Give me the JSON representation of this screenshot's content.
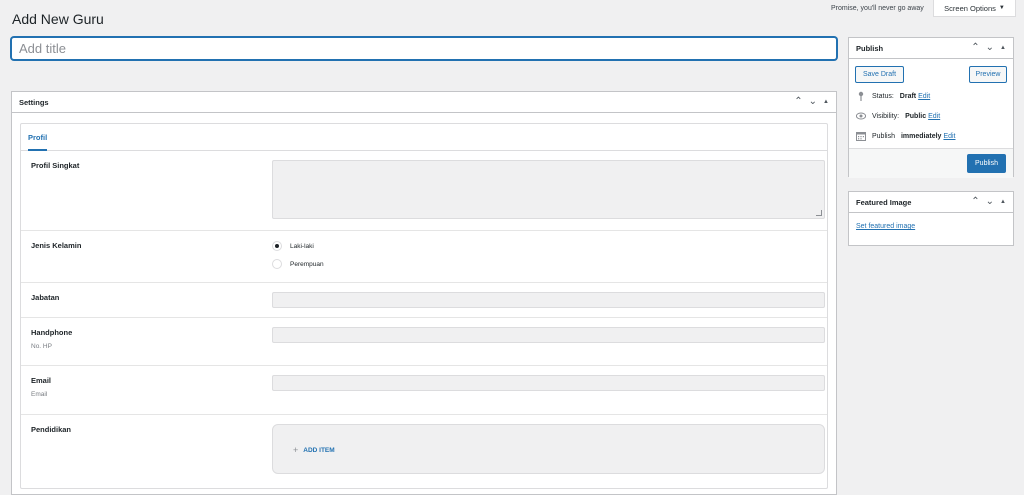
{
  "header": {
    "title": "Add New Guru",
    "tagline": "Promise, you'll never go away",
    "screen_options_label": "Screen Options"
  },
  "title_field": {
    "placeholder": "Add title",
    "value": ""
  },
  "settings": {
    "title": "Settings",
    "tabs": [
      {
        "label": "Profil",
        "active": true
      }
    ],
    "fields": {
      "profil_singkat": {
        "label": "Profil Singkat",
        "value": ""
      },
      "jenis_kelamin": {
        "label": "Jenis Kelamin",
        "options": [
          {
            "label": "Laki-laki",
            "checked": true
          },
          {
            "label": "Perempuan",
            "checked": false
          }
        ]
      },
      "jabatan": {
        "label": "Jabatan",
        "value": ""
      },
      "handphone": {
        "label": "Handphone",
        "hint": "No. HP",
        "value": ""
      },
      "email": {
        "label": "Email",
        "hint": "Email",
        "value": ""
      },
      "pendidikan": {
        "label": "Pendidikan",
        "add_item_label": "ADD ITEM"
      }
    }
  },
  "publish": {
    "title": "Publish",
    "save_draft_label": "Save Draft",
    "preview_label": "Preview",
    "status": {
      "label": "Status:",
      "value": "Draft",
      "edit": "Edit"
    },
    "visibility": {
      "label": "Visibility:",
      "value": "Public",
      "edit": "Edit"
    },
    "schedule": {
      "label": "Publish",
      "value": "immediately",
      "edit": "Edit"
    },
    "publish_label": "Publish"
  },
  "featured_image": {
    "title": "Featured Image",
    "link_label": "Set featured image"
  },
  "icons": {
    "collapse_up": "chevron-up-icon",
    "collapse_down": "chevron-down-icon",
    "toggle": "triangle-up-icon",
    "status": "pin-icon",
    "visibility": "eye-icon",
    "schedule": "calendar-icon"
  },
  "colors": {
    "accent": "#2271b1",
    "background": "#f0f0f1",
    "border": "#c3c4c7"
  }
}
